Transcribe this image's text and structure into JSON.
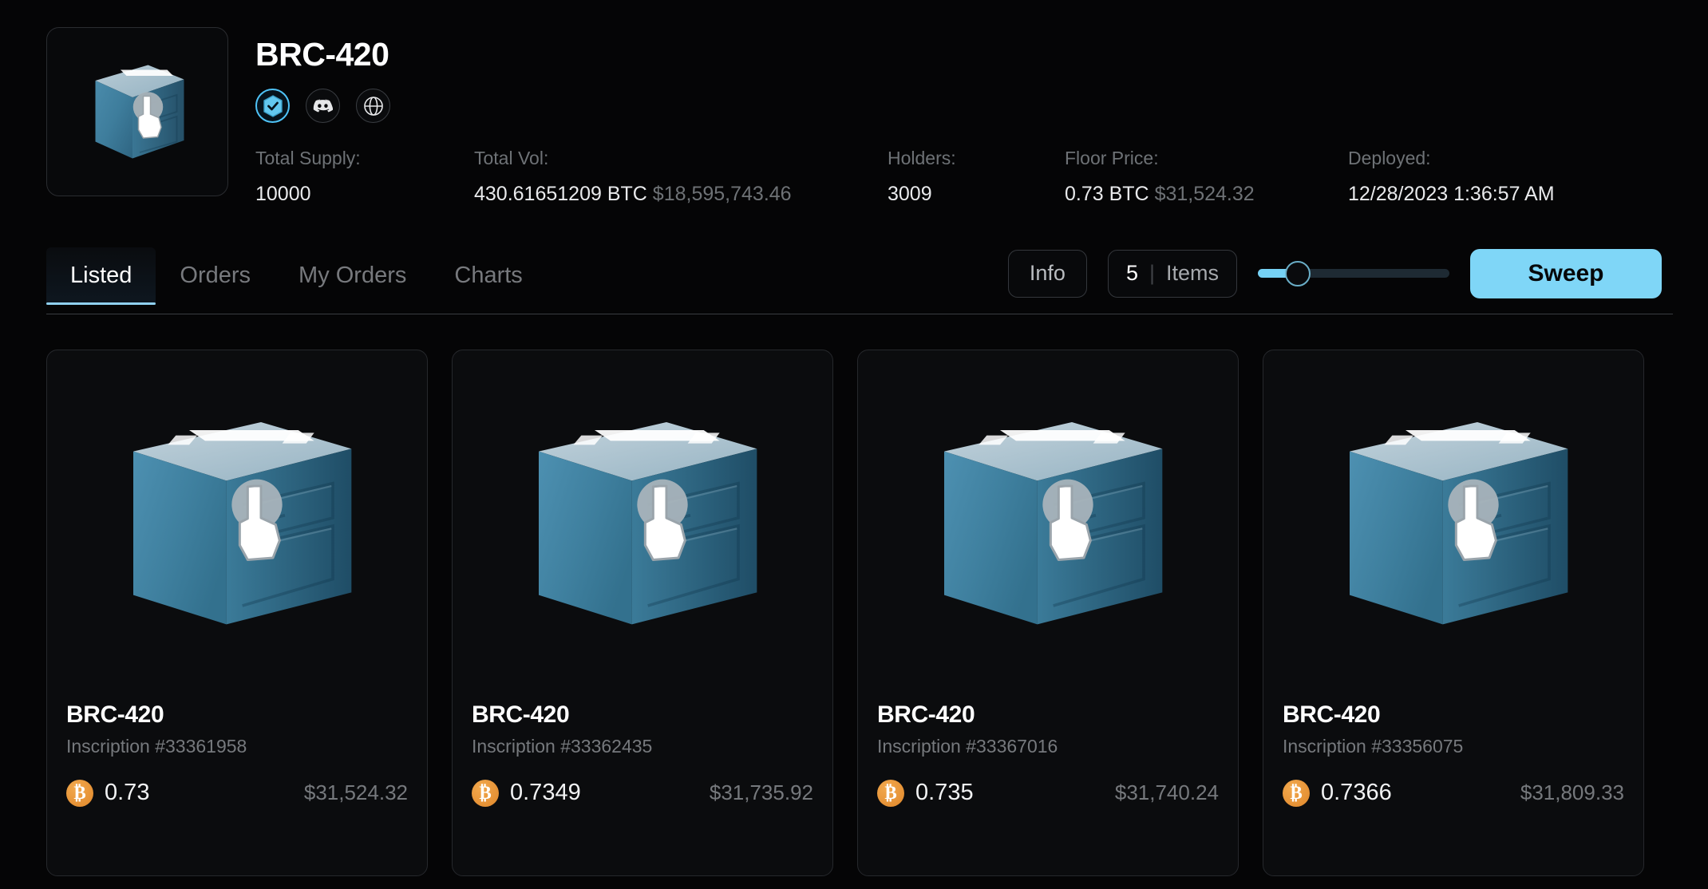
{
  "collection": {
    "name": "BRC-420",
    "badges": [
      {
        "name": "verified-badge",
        "icon": "verified-shield-icon"
      },
      {
        "name": "discord-link",
        "icon": "discord-icon"
      },
      {
        "name": "website-link",
        "icon": "globe-icon"
      }
    ],
    "thumbnail_icon": "brc420-box-icon"
  },
  "stats": [
    {
      "label": "Total Supply:",
      "value": "10000",
      "sub": ""
    },
    {
      "label": "Total Vol:",
      "value": "430.61651209 BTC",
      "sub": "$18,595,743.46"
    },
    {
      "label": "Holders:",
      "value": "3009",
      "sub": ""
    },
    {
      "label": "Floor Price:",
      "value": "0.73 BTC",
      "sub": "$31,524.32"
    },
    {
      "label": "Deployed:",
      "value": "12/28/2023 1:36:57 AM",
      "sub": ""
    }
  ],
  "toolbar": {
    "tabs": [
      {
        "label": "Listed",
        "active": true
      },
      {
        "label": "Orders",
        "active": false
      },
      {
        "label": "My Orders",
        "active": false
      },
      {
        "label": "Charts",
        "active": false
      }
    ],
    "info_label": "Info",
    "items_count": "5",
    "items_divider": "|",
    "items_label": "Items",
    "sweep_label": "Sweep",
    "slider_value_percent": 20,
    "accent_color": "#7fd6f7"
  },
  "cards": [
    {
      "title": "BRC-420",
      "inscription": "Inscription #33361958",
      "price_btc": "0.73",
      "price_usd": "$31,524.32",
      "art_icon": "brc420-box-icon"
    },
    {
      "title": "BRC-420",
      "inscription": "Inscription #33362435",
      "price_btc": "0.7349",
      "price_usd": "$31,735.92",
      "art_icon": "brc420-box-icon"
    },
    {
      "title": "BRC-420",
      "inscription": "Inscription #33367016",
      "price_btc": "0.735",
      "price_usd": "$31,740.24",
      "art_icon": "brc420-box-icon"
    },
    {
      "title": "BRC-420",
      "inscription": "Inscription #33356075",
      "price_btc": "0.7366",
      "price_usd": "$31,809.33",
      "art_icon": "brc420-box-icon"
    }
  ],
  "btc_symbol": "₿"
}
